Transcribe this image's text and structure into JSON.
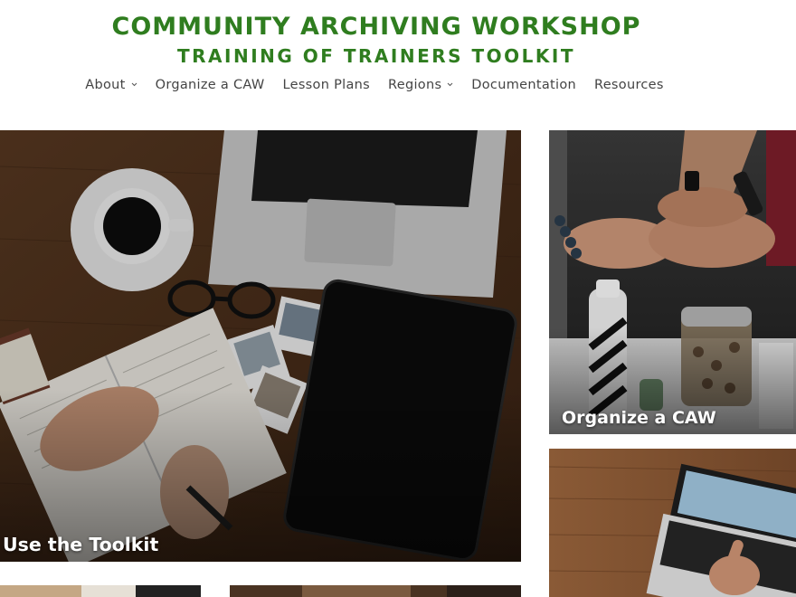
{
  "site": {
    "title_line1": "COMMUNITY ARCHIVING WORKSHOP",
    "title_line2": "TRAINING OF TRAINERS TOOLKIT",
    "brand_color": "#2f7d1f"
  },
  "nav": {
    "items": [
      {
        "label": "About",
        "has_dropdown": true
      },
      {
        "label": "Organize a CAW",
        "has_dropdown": false
      },
      {
        "label": "Lesson Plans",
        "has_dropdown": false
      },
      {
        "label": "Regions",
        "has_dropdown": true
      },
      {
        "label": "Documentation",
        "has_dropdown": false
      },
      {
        "label": "Resources",
        "has_dropdown": false
      }
    ]
  },
  "tiles": {
    "toolkit": {
      "label": "Use the Toolkit",
      "image": "desk-with-laptop-tablet-notebook"
    },
    "organize": {
      "label": "Organize a CAW",
      "image": "hands-fist-bump"
    },
    "laptop": {
      "label": "",
      "image": "hands-typing-on-laptop"
    }
  }
}
